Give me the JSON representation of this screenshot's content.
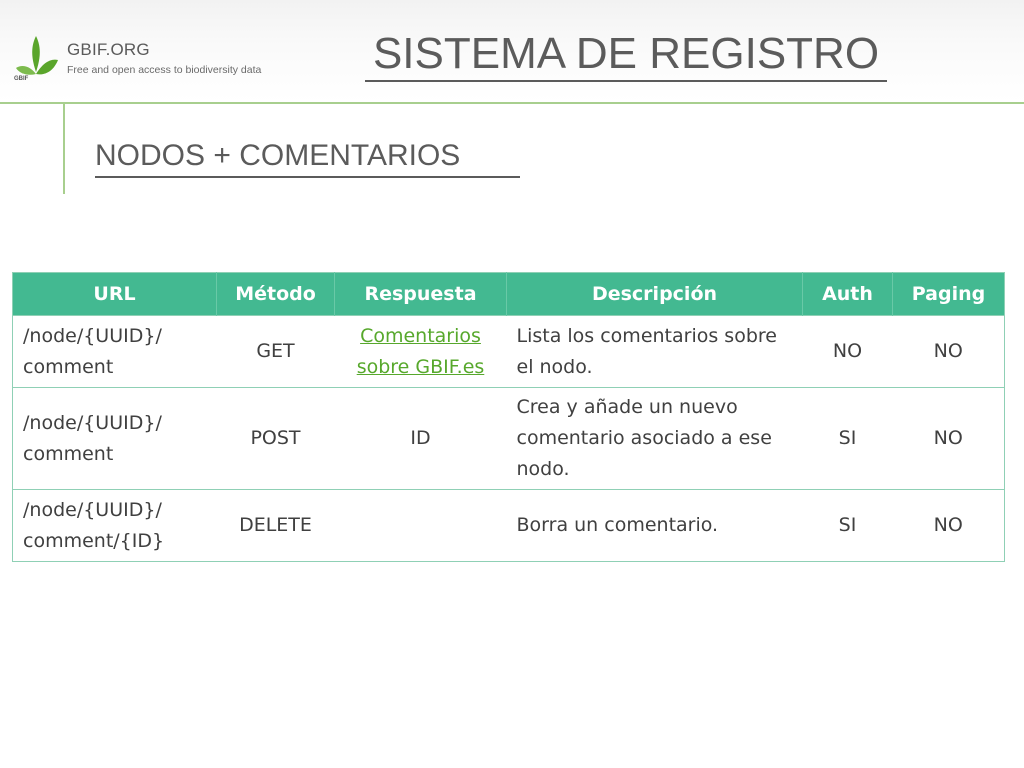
{
  "header": {
    "brand_name": "GBIF.ORG",
    "brand_tagline": "Free and open access to biodiversity data",
    "logo_text": "GBIF",
    "title": "SISTEMA DE REGISTRO"
  },
  "section": {
    "subtitle": "NODOS + COMENTARIOS"
  },
  "colors": {
    "header_fill": "#43b991",
    "link": "#57a82c",
    "auth_yes": "#c0392b",
    "accent_rule": "#a8cf8e"
  },
  "table": {
    "columns": [
      "URL",
      "Método",
      "Respuesta",
      "Descripción",
      "Auth",
      "Paging"
    ],
    "rows": [
      {
        "url": "/node/{UUID}/ comment",
        "method": "GET",
        "response": "Comentarios sobre GBIF.es",
        "description": "Lista los comentarios sobre el nodo.",
        "auth": "NO",
        "paging": "NO"
      },
      {
        "url": "/node/{UUID}/ comment",
        "method": "POST",
        "response": "ID",
        "description": "Crea y añade un nuevo comentario asociado a ese nodo.",
        "auth": "SI",
        "paging": "NO"
      },
      {
        "url": "/node/{UUID}/ comment/{ID}",
        "method": "DELETE",
        "response": "",
        "description": "Borra un comentario.",
        "auth": "SI",
        "paging": "NO"
      }
    ]
  }
}
